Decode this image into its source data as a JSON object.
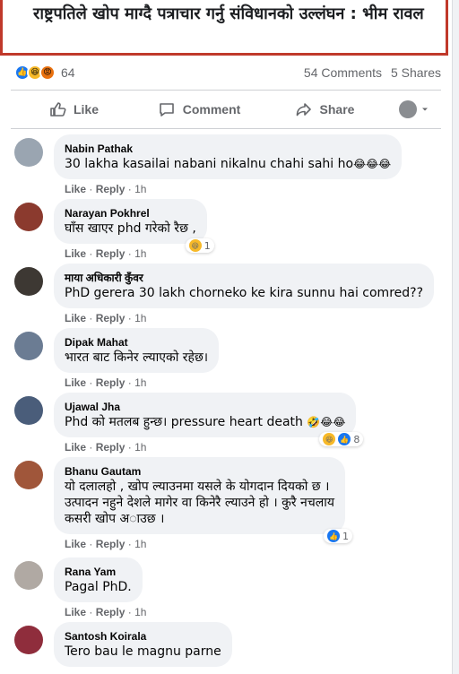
{
  "post": {
    "link_title": "राष्ट्रपतिले खोप माग्दै पत्राचार गर्नु संविधानको उल्लंघन : भीम रावल"
  },
  "reactions": {
    "count": "64",
    "comments": "54 Comments",
    "shares": "5 Shares",
    "icons": [
      "like-icon",
      "haha-icon",
      "angry-icon"
    ]
  },
  "actions": {
    "like": "Like",
    "comment": "Comment",
    "share": "Share"
  },
  "comment_meta": {
    "like": "Like",
    "reply": "Reply",
    "sep": "·",
    "time": "1h"
  },
  "comments": [
    {
      "name": "Nabin Pathak",
      "text": "30 lakha kasailai nabani nikalnu chahi sahi ho",
      "emojis": "😂😂😂",
      "avatar_color": "#9aa5b1"
    },
    {
      "name": "Narayan Pokhrel",
      "text": "घाँस खाएर phd गरेको रैछ ,",
      "badge_count": "1",
      "avatar_color": "#8b3a2e"
    },
    {
      "name": "माया अधिकारी कुँवर",
      "text": "PhD gerera 30 lakh chorneko ke kira sunnu hai comred??",
      "avatar_color": "#3d3833"
    },
    {
      "name": "Dipak Mahat",
      "text": "भारत बाट किनेर ल्याएको रहेछ।",
      "avatar_color": "#6b7c93"
    },
    {
      "name": "Ujawal Jha",
      "text": "Phd को मतलब हुन्छ। pressure heart death",
      "emojis": "🤣😂😂",
      "badge_count": "8",
      "avatar_color": "#4a5d7a"
    },
    {
      "name": "Bhanu Gautam",
      "lines": [
        "यो दलालहो , खोप ल्याउनमा यसले के योगदान दियको छ ।",
        "उत्पादन नहुने देशले मागेर वा किनेरै ल्याउने हो । कुरै नचलाय",
        "कसरी खोप अाउछ ।"
      ],
      "badge_count": "1",
      "avatar_color": "#a0563a"
    },
    {
      "name": "Rana Yam",
      "text": "Pagal PhD.",
      "avatar_color": "#b0a9a3"
    },
    {
      "name": "Santosh Koirala",
      "text": "Tero bau le magnu parne",
      "avatar_color": "#8f2d3c"
    }
  ]
}
